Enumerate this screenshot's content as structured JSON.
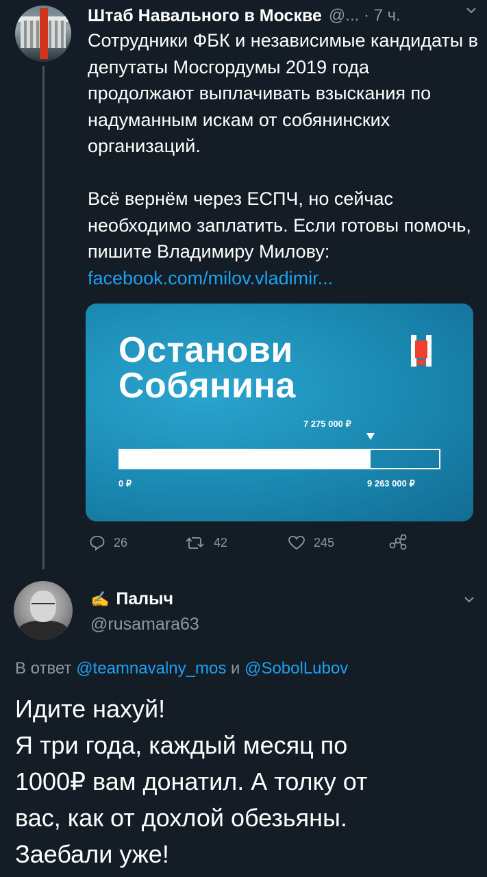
{
  "tweet1": {
    "author_name": "Штаб Навального в Москве",
    "author_meta": "@... · 7 ч.",
    "paragraph1": "Сотрудники ФБК и независимые кандидаты в депутаты Мосгордумы 2019 года продолжают выплачивать взыскания по надуманным искам от собянинских организаций.",
    "paragraph2": "Всё вернём через ЕСПЧ, но сейчас необходимо заплатить. Если готовы помочь, пишите Владимиру Милову:",
    "link": "facebook.com/milov.vladimir...",
    "card": {
      "title_line1": "Останови",
      "title_line2": "Собянина",
      "current_amount": "7 275 000 ₽",
      "start_amount": "0 ₽",
      "goal_amount": "9 263 000 ₽",
      "progress_fraction": 0.785,
      "bg_color": "#1b8bb4",
      "logo_color": "#f0402e"
    },
    "actions": {
      "replies": "26",
      "retweets": "42",
      "likes": "245"
    }
  },
  "tweet2": {
    "author_name": "Палыч",
    "author_handle": "@rusamara63",
    "reply_prefix": "В ответ",
    "reply_user1": "@teamnavalny_mos",
    "reply_and": "и",
    "reply_user2": "@SobolLubov",
    "lines": [
      "Идите нахуй!",
      "Я три года, каждый месяц по",
      "1000₽ вам донатил. А толку от",
      "вас, как от дохлой обезьяны.",
      "Заебали уже!"
    ]
  },
  "colors": {
    "background": "#141d26",
    "secondary_text": "#8899a6",
    "link": "#1da1f2"
  },
  "icons": [
    "reply-icon",
    "retweet-icon",
    "like-icon",
    "share-icon",
    "chevron-down-icon",
    "pen-icon"
  ]
}
